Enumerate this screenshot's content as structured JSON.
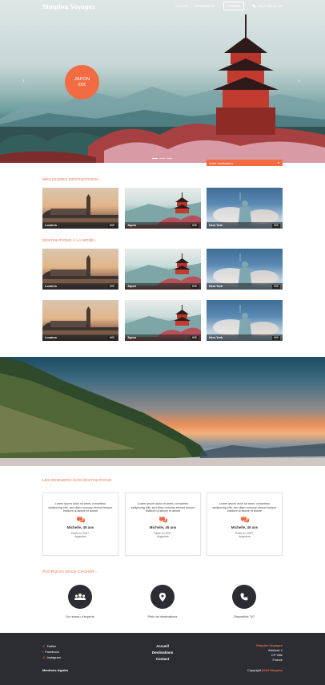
{
  "header": {
    "logo": "Simplon Voyagez",
    "nav": [
      "Accueil",
      "Destinations"
    ],
    "contact_button": "Contact",
    "phone": "05.24.95.94.85"
  },
  "hero": {
    "badge_line1": "JAPON",
    "badge_line2": "€€€",
    "search_label": "Votre destination",
    "search_chevron": "▾",
    "prev_arrow": "‹",
    "next_arrow": "›"
  },
  "sections": {
    "best": "MEILLEURES DESTINATIONS  ›",
    "trend": "DESTINATIONS À LA MODE  ›",
    "reviews": "LES DERNIERS AVIS DESTINATIONS",
    "why": "POURQUOI NOUS CHOISIR  ›"
  },
  "cards": {
    "london": {
      "name": "Londres",
      "price": "€€€"
    },
    "japan": {
      "name": "Japon",
      "price": "€€€"
    },
    "ny": {
      "name": "New-York",
      "price": "€€€"
    }
  },
  "review": {
    "text": "Lorem ipsum dolor sit amet, consetetur sadipscing elitr, sed diam nonumy eirmod tempor invidunt ut labore et dolore",
    "name": "Michelle, 45 ans",
    "meta1": "Partie en 2007,",
    "meta2": "Argentine"
  },
  "why": {
    "experts": "Un réseau d'experts",
    "destinations": "Plein de destinations",
    "available": "Disponible 7j/7"
  },
  "footer": {
    "twitter": "Twitter",
    "facebook": "Facebook",
    "instagram": "Instagram",
    "links": [
      "Accueil",
      "Destinations",
      "Contact"
    ],
    "brand": "Simplon Voyages",
    "address1": "Adresse 1",
    "address2": "CP Ville",
    "country": "France",
    "legal": "Mentions légales",
    "copyright_prefix": "Copyright",
    "copyright_year": "2020 Simplon"
  },
  "colors": {
    "accent": "#f26b43",
    "dark": "#2b2d33"
  }
}
